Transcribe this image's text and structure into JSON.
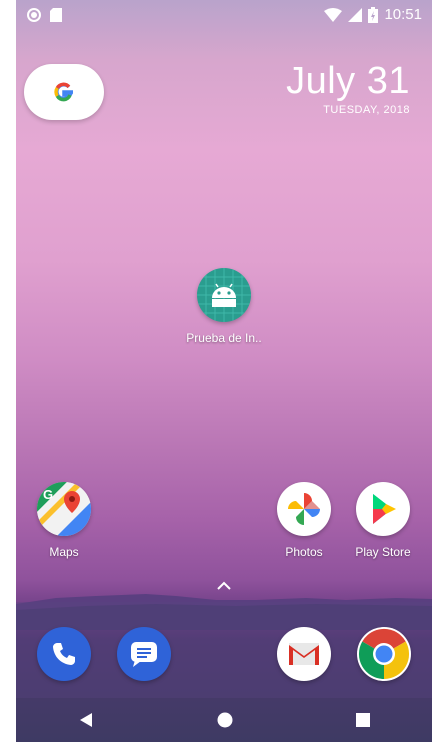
{
  "status_bar": {
    "time": "10:51"
  },
  "date_widget": {
    "date": "July 31",
    "day_year": "TUESDAY, 2018"
  },
  "apps": {
    "prueba": "Prueba de In..",
    "maps": "Maps",
    "photos": "Photos",
    "play_store": "Play Store"
  },
  "dock_icons": [
    "phone-icon",
    "messages-icon",
    "gmail-icon",
    "chrome-icon"
  ],
  "nav_icons": [
    "back-icon",
    "home-icon",
    "recents-icon"
  ]
}
